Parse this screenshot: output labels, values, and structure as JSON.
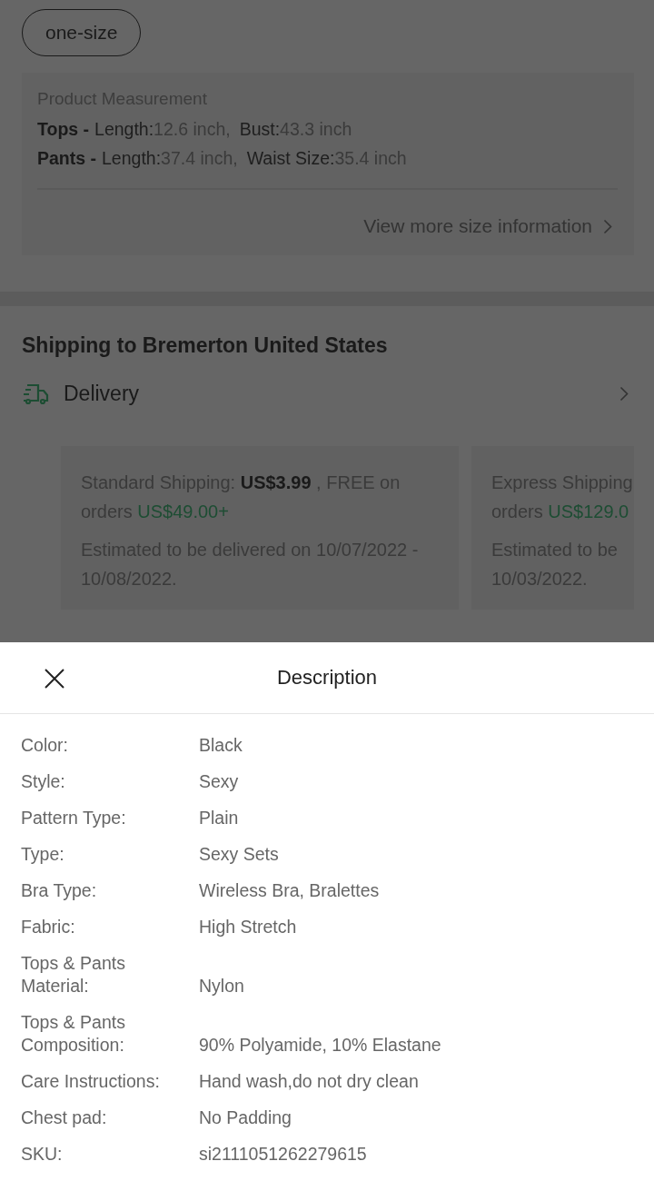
{
  "size_options": [
    {
      "label": "one-size",
      "selected": true
    }
  ],
  "measurement": {
    "title": "Product Measurement",
    "parts": [
      {
        "name": "Tops -",
        "items": [
          {
            "label": "Length:",
            "value": "12.6 inch,"
          },
          {
            "label": "Bust:",
            "value": "43.3 inch"
          }
        ]
      },
      {
        "name": "Pants -",
        "items": [
          {
            "label": "Length:",
            "value": "37.4 inch,"
          },
          {
            "label": "Waist Size:",
            "value": "35.4 inch"
          }
        ]
      }
    ],
    "more_link": "View more size information"
  },
  "shipping": {
    "title": "Shipping to Bremerton United States",
    "delivery_label": "Delivery",
    "options": [
      {
        "label": "Standard Shipping:",
        "price": "US$3.99",
        "free_note": ", FREE on",
        "orders": "orders",
        "threshold": "US$49.00+",
        "estimate": "Estimated to be delivered on 10/07/2022 - 10/08/2022."
      },
      {
        "label": "Express Shipping",
        "orders": "orders",
        "threshold": "US$129.0",
        "estimate": "Estimated to be",
        "estimate_2": "10/03/2022."
      }
    ]
  },
  "sheet": {
    "title": "Description",
    "rows": [
      {
        "label": "Color:",
        "value": "Black"
      },
      {
        "label": "Style:",
        "value": "Sexy"
      },
      {
        "label": "Pattern Type:",
        "value": "Plain"
      },
      {
        "label": "Type:",
        "value": "Sexy Sets"
      },
      {
        "label": "Bra Type:",
        "value": "Wireless Bra, Bralettes"
      },
      {
        "label": "Fabric:",
        "value": "High Stretch"
      },
      {
        "label": "Tops & Pants Material:",
        "value": "Nylon"
      },
      {
        "label": "Tops & Pants Composition:",
        "value": "90% Polyamide, 10% Elastane"
      },
      {
        "label": "Care Instructions:",
        "value": "Hand wash,do not dry clean"
      },
      {
        "label": "Chest pad:",
        "value": "No Padding"
      },
      {
        "label": "SKU:",
        "value": "si2111051262279615"
      }
    ]
  }
}
